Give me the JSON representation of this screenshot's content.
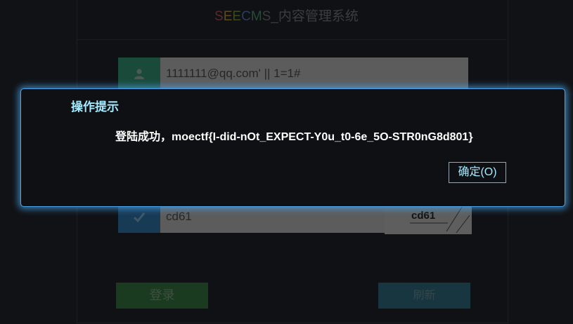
{
  "header": {
    "brand_letters": [
      "S",
      "E",
      "E",
      "C",
      "M",
      "S"
    ],
    "brand_colors": [
      "#5a2a2a",
      "#5a4a1e",
      "#3a4a1e",
      "#2a3d5a",
      "#2a4a3a",
      "#3a3a3a"
    ],
    "brand_suffix": "_内容管理系统"
  },
  "login": {
    "username_value": "1111111@qq.com' || 1=1#",
    "password_value": "•••",
    "captcha_value": "cd61",
    "captcha_image_text": "cd61",
    "login_button": "登录",
    "refresh_button": "刷新",
    "icons": {
      "username": "user-icon",
      "password": "lock-icon",
      "captcha": "check-icon"
    }
  },
  "dialog": {
    "title": "操作提示",
    "message": "登陆成功，moectf{I-did-nOt_EXPECT-Y0u_t0-6e_5O-STR0nG8d801}",
    "ok_button": "确定(O)",
    "accent": "#4aa3e8"
  }
}
